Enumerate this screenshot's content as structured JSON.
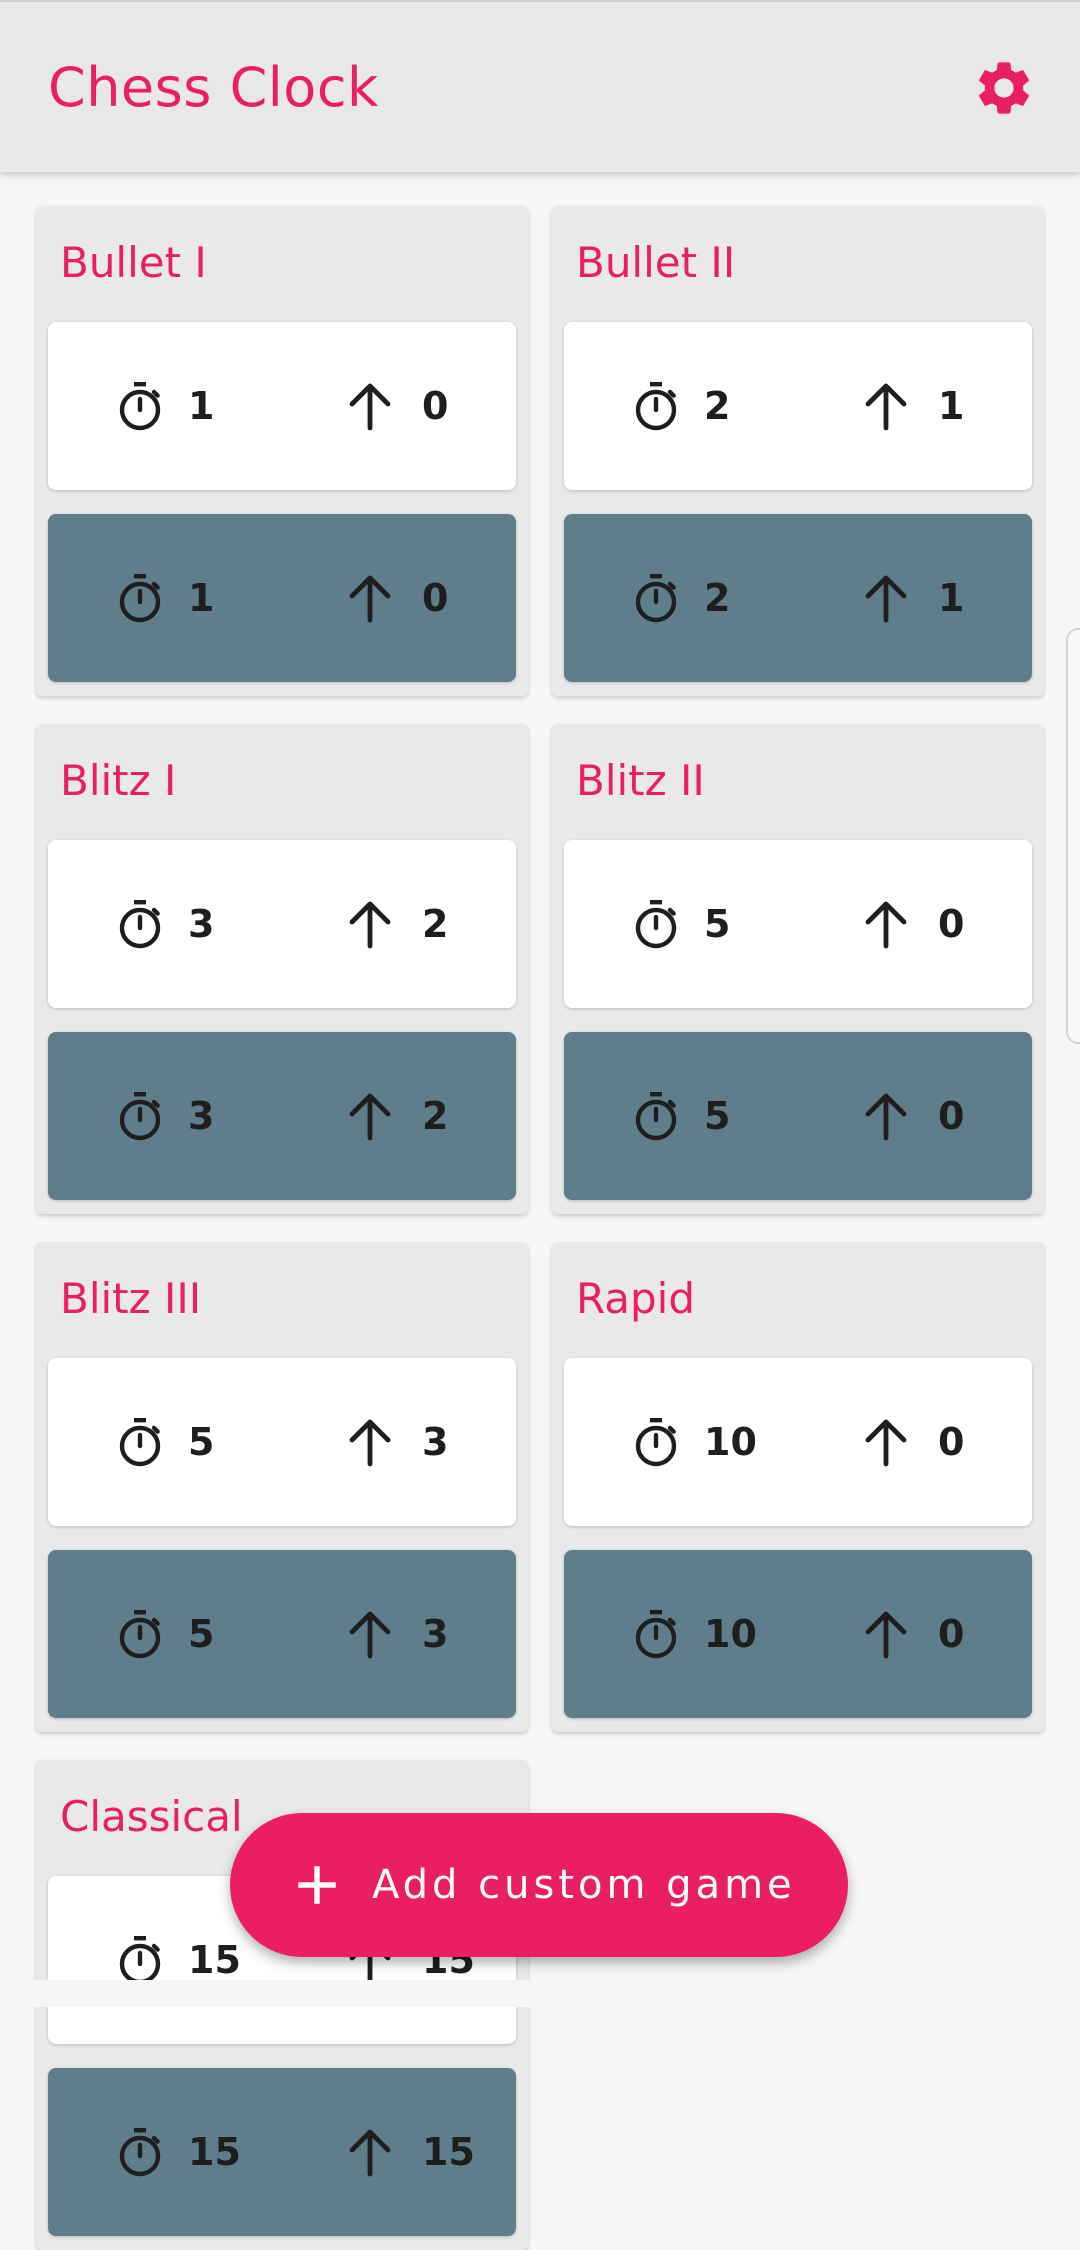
{
  "app": {
    "title": "Chess Clock",
    "accent": "#e91e63"
  },
  "icons": {
    "settings": "gear-icon",
    "timer": "timer-icon",
    "increment": "arrow-up-icon",
    "add": "plus-icon"
  },
  "presets": [
    {
      "name": "Bullet I",
      "white": {
        "time": "1",
        "increment": "0"
      },
      "black": {
        "time": "1",
        "increment": "0"
      }
    },
    {
      "name": "Bullet II",
      "white": {
        "time": "2",
        "increment": "1"
      },
      "black": {
        "time": "2",
        "increment": "1"
      }
    },
    {
      "name": "Blitz I",
      "white": {
        "time": "3",
        "increment": "2"
      },
      "black": {
        "time": "3",
        "increment": "2"
      }
    },
    {
      "name": "Blitz II",
      "white": {
        "time": "5",
        "increment": "0"
      },
      "black": {
        "time": "5",
        "increment": "0"
      }
    },
    {
      "name": "Blitz III",
      "white": {
        "time": "5",
        "increment": "3"
      },
      "black": {
        "time": "5",
        "increment": "3"
      }
    },
    {
      "name": "Rapid",
      "white": {
        "time": "10",
        "increment": "0"
      },
      "black": {
        "time": "10",
        "increment": "0"
      }
    },
    {
      "name": "Classical",
      "white": {
        "time": "15",
        "increment": "15"
      },
      "black": {
        "time": "15",
        "increment": "15"
      }
    }
  ],
  "fab": {
    "label": "Add custom game"
  },
  "colors": {
    "white_panel": "#ffffff",
    "black_panel": "#607d8b",
    "card": "#e9e9e9",
    "appbar": "#e8e8e8"
  }
}
